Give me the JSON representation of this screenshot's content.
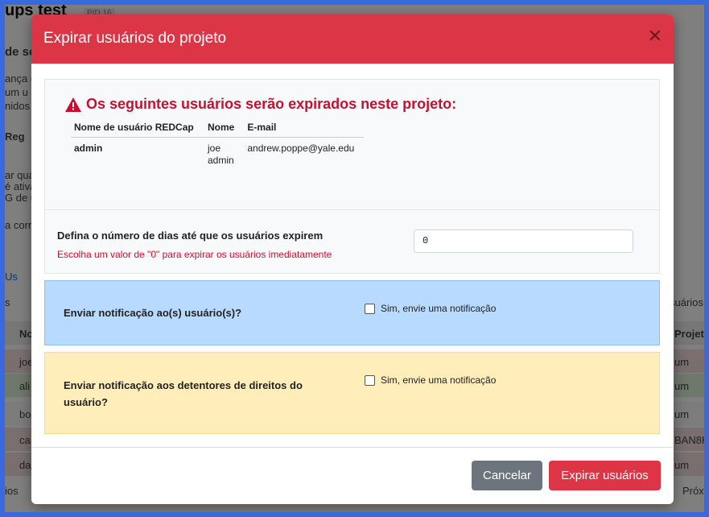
{
  "background": {
    "title": "ups test",
    "pid": "PID 16",
    "left_fragments": [
      "de se",
      "ança (",
      "um u",
      "nidos",
      "Reg",
      "ar qua",
      "é ativa",
      "G de u",
      "a corr",
      "Us",
      "s",
      "No",
      "joe",
      "ali",
      "bo",
      "ca",
      "da",
      "ios"
    ],
    "right_fragments": [
      "suários",
      "Projet",
      "um",
      "um",
      "um",
      "BAN8H",
      "um",
      "Próx"
    ]
  },
  "modal": {
    "title": "Expirar usuários do projeto",
    "close_icon": "close-icon",
    "warning": {
      "icon": "warning-triangle-icon",
      "text": "Os seguintes usuários serão expirados neste projeto:"
    },
    "table": {
      "headers": [
        "Nome de usuário REDCap",
        "Nome",
        "E-mail"
      ],
      "rows": [
        {
          "username": "admin",
          "name_line1": "joe",
          "name_line2": "admin",
          "email": "andrew.poppe@yale.edu"
        }
      ]
    },
    "days": {
      "label": "Defina o número de dias até que os usuários expirem",
      "hint": "Escolha um valor de \"0\" para expirar os usuários imediatamente",
      "value": "0"
    },
    "notify_users": {
      "label": "Enviar notificação ao(s) usuário(s)?",
      "checkbox_label": "Sim, envie uma notificação"
    },
    "notify_rights": {
      "label_line1": "Enviar notificação aos detentores de direitos do",
      "label_line2": "usuário?",
      "checkbox_label": "Sim, envie uma notificação"
    },
    "buttons": {
      "cancel": "Cancelar",
      "expire": "Expirar usuários"
    }
  },
  "colors": {
    "header": "#dc3545",
    "info_bg": "#b8daff",
    "warning_bg": "#ffeeba",
    "danger_text": "#c8102e"
  }
}
